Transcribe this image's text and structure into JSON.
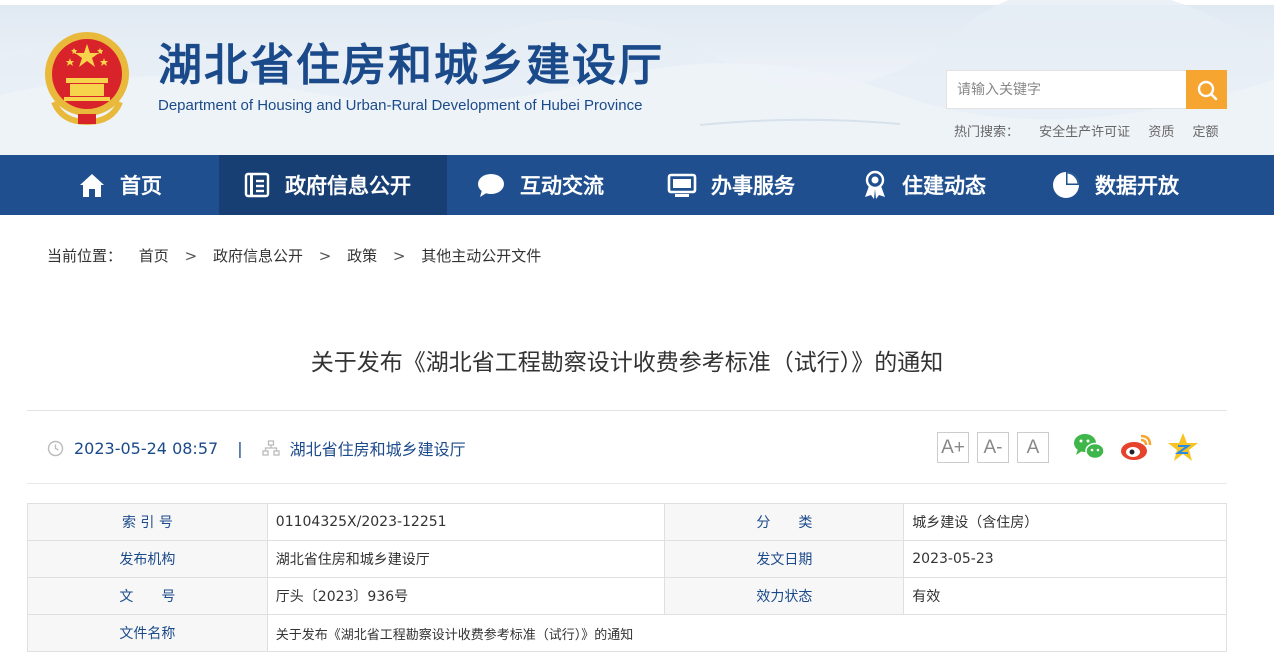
{
  "header": {
    "title": "湖北省住房和城乡建设厅",
    "subtitle": "Department of Housing and Urban-Rural Development of Hubei Province",
    "search_placeholder": "请输入关键字",
    "hot_label": "热门搜索：",
    "hot_terms": [
      "安全生产许可证",
      "资质",
      "定额"
    ]
  },
  "nav": {
    "items": [
      {
        "label": "首页",
        "icon": "home-icon"
      },
      {
        "label": "政府信息公开",
        "icon": "document-icon"
      },
      {
        "label": "互动交流",
        "icon": "chat-icon"
      },
      {
        "label": "办事服务",
        "icon": "monitor-icon"
      },
      {
        "label": "住建动态",
        "icon": "medal-icon"
      },
      {
        "label": "数据开放",
        "icon": "pie-chart-icon"
      }
    ],
    "active_index": 1
  },
  "breadcrumb": {
    "label": "当前位置：",
    "items": [
      "首页",
      "政府信息公开",
      "政策",
      "其他主动公开文件"
    ],
    "separator": ">"
  },
  "article": {
    "title": "关于发布《湖北省工程勘察设计收费参考标准（试行）》的通知",
    "datetime": "2023-05-24 08:57",
    "meta_separator": "|",
    "source": "湖北省住房和城乡建设厅",
    "font_sizes": [
      "A+",
      "A-",
      "A"
    ],
    "share": [
      "wechat-icon",
      "weibo-icon",
      "qzone-icon"
    ]
  },
  "info_table": {
    "index_no_label": "索 引 号",
    "index_no": "01104325X/2023-12251",
    "category_label": "分　　类",
    "category": "城乡建设（含住房）",
    "issuer_label": "发布机构",
    "issuer": "湖北省住房和城乡建设厅",
    "issue_date_label": "发文日期",
    "issue_date": "2023-05-23",
    "doc_no_label": "文　　号",
    "doc_no": "厅头〔2023〕936号",
    "status_label": "效力状态",
    "status": "有效",
    "doc_name_label": "文件名称",
    "doc_name": "关于发布《湖北省工程勘察设计收费参考标准（试行）》的通知"
  },
  "colors": {
    "primary": "#1f4f8f",
    "nav_active": "#183f73",
    "accent": "#f5a530",
    "title_blue": "#1b4a8a"
  }
}
